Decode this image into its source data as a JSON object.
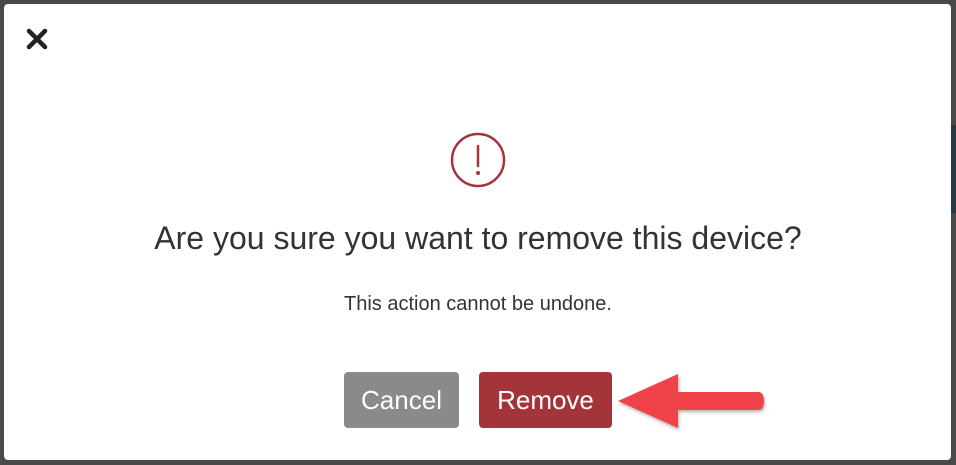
{
  "dialog": {
    "close_icon": "close-icon",
    "warning_icon": "exclamation-circle-icon",
    "title": "Are you sure you want to remove this device?",
    "message": "This action cannot be undone.",
    "cancel_label": "Cancel",
    "remove_label": "Remove"
  },
  "colors": {
    "accent_danger": "#a3343a",
    "cancel_gray": "#8a8a8a",
    "annotation_arrow": "#f0424a",
    "text": "#333333"
  },
  "annotation": {
    "arrow_icon": "arrow-left-icon"
  }
}
